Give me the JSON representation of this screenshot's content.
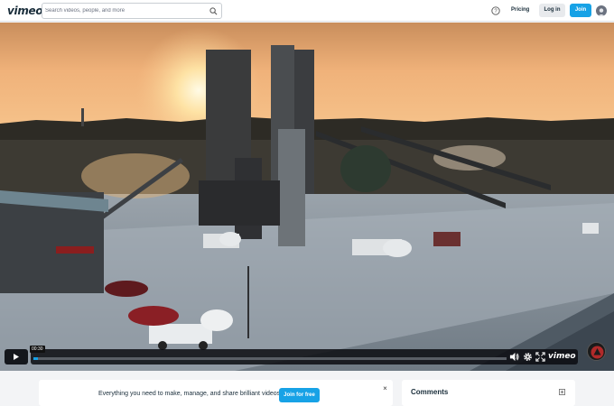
{
  "header": {
    "logo": "vimeo",
    "search_placeholder": "Search videos, people, and more",
    "pricing_label": "Pricing",
    "login_label": "Log in",
    "join_label": "Join"
  },
  "player": {
    "current_time": "00:30",
    "progress": 0.01,
    "brand_mark": "vimeo",
    "icons": [
      "play-icon",
      "volume-icon",
      "settings-icon",
      "fullscreen-icon"
    ]
  },
  "promo": {
    "text": "Everything you need to make, manage, and share brilliant videos.",
    "button_label": "Join for free",
    "close_label": "×"
  },
  "comments": {
    "title": "Comments"
  },
  "colors": {
    "accent": "#17a2e6",
    "text": "#1a2e3b"
  }
}
